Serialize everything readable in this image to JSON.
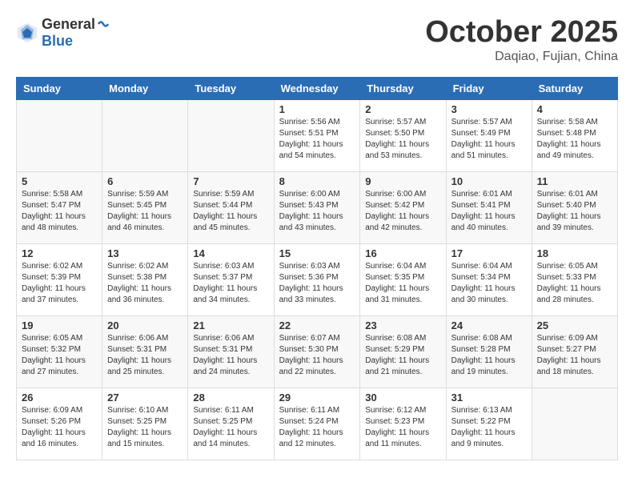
{
  "header": {
    "logo_general": "General",
    "logo_blue": "Blue",
    "month": "October 2025",
    "location": "Daqiao, Fujian, China"
  },
  "weekdays": [
    "Sunday",
    "Monday",
    "Tuesday",
    "Wednesday",
    "Thursday",
    "Friday",
    "Saturday"
  ],
  "weeks": [
    [
      {
        "day": "",
        "info": ""
      },
      {
        "day": "",
        "info": ""
      },
      {
        "day": "",
        "info": ""
      },
      {
        "day": "1",
        "info": "Sunrise: 5:56 AM\nSunset: 5:51 PM\nDaylight: 11 hours\nand 54 minutes."
      },
      {
        "day": "2",
        "info": "Sunrise: 5:57 AM\nSunset: 5:50 PM\nDaylight: 11 hours\nand 53 minutes."
      },
      {
        "day": "3",
        "info": "Sunrise: 5:57 AM\nSunset: 5:49 PM\nDaylight: 11 hours\nand 51 minutes."
      },
      {
        "day": "4",
        "info": "Sunrise: 5:58 AM\nSunset: 5:48 PM\nDaylight: 11 hours\nand 49 minutes."
      }
    ],
    [
      {
        "day": "5",
        "info": "Sunrise: 5:58 AM\nSunset: 5:47 PM\nDaylight: 11 hours\nand 48 minutes."
      },
      {
        "day": "6",
        "info": "Sunrise: 5:59 AM\nSunset: 5:45 PM\nDaylight: 11 hours\nand 46 minutes."
      },
      {
        "day": "7",
        "info": "Sunrise: 5:59 AM\nSunset: 5:44 PM\nDaylight: 11 hours\nand 45 minutes."
      },
      {
        "day": "8",
        "info": "Sunrise: 6:00 AM\nSunset: 5:43 PM\nDaylight: 11 hours\nand 43 minutes."
      },
      {
        "day": "9",
        "info": "Sunrise: 6:00 AM\nSunset: 5:42 PM\nDaylight: 11 hours\nand 42 minutes."
      },
      {
        "day": "10",
        "info": "Sunrise: 6:01 AM\nSunset: 5:41 PM\nDaylight: 11 hours\nand 40 minutes."
      },
      {
        "day": "11",
        "info": "Sunrise: 6:01 AM\nSunset: 5:40 PM\nDaylight: 11 hours\nand 39 minutes."
      }
    ],
    [
      {
        "day": "12",
        "info": "Sunrise: 6:02 AM\nSunset: 5:39 PM\nDaylight: 11 hours\nand 37 minutes."
      },
      {
        "day": "13",
        "info": "Sunrise: 6:02 AM\nSunset: 5:38 PM\nDaylight: 11 hours\nand 36 minutes."
      },
      {
        "day": "14",
        "info": "Sunrise: 6:03 AM\nSunset: 5:37 PM\nDaylight: 11 hours\nand 34 minutes."
      },
      {
        "day": "15",
        "info": "Sunrise: 6:03 AM\nSunset: 5:36 PM\nDaylight: 11 hours\nand 33 minutes."
      },
      {
        "day": "16",
        "info": "Sunrise: 6:04 AM\nSunset: 5:35 PM\nDaylight: 11 hours\nand 31 minutes."
      },
      {
        "day": "17",
        "info": "Sunrise: 6:04 AM\nSunset: 5:34 PM\nDaylight: 11 hours\nand 30 minutes."
      },
      {
        "day": "18",
        "info": "Sunrise: 6:05 AM\nSunset: 5:33 PM\nDaylight: 11 hours\nand 28 minutes."
      }
    ],
    [
      {
        "day": "19",
        "info": "Sunrise: 6:05 AM\nSunset: 5:32 PM\nDaylight: 11 hours\nand 27 minutes."
      },
      {
        "day": "20",
        "info": "Sunrise: 6:06 AM\nSunset: 5:31 PM\nDaylight: 11 hours\nand 25 minutes."
      },
      {
        "day": "21",
        "info": "Sunrise: 6:06 AM\nSunset: 5:31 PM\nDaylight: 11 hours\nand 24 minutes."
      },
      {
        "day": "22",
        "info": "Sunrise: 6:07 AM\nSunset: 5:30 PM\nDaylight: 11 hours\nand 22 minutes."
      },
      {
        "day": "23",
        "info": "Sunrise: 6:08 AM\nSunset: 5:29 PM\nDaylight: 11 hours\nand 21 minutes."
      },
      {
        "day": "24",
        "info": "Sunrise: 6:08 AM\nSunset: 5:28 PM\nDaylight: 11 hours\nand 19 minutes."
      },
      {
        "day": "25",
        "info": "Sunrise: 6:09 AM\nSunset: 5:27 PM\nDaylight: 11 hours\nand 18 minutes."
      }
    ],
    [
      {
        "day": "26",
        "info": "Sunrise: 6:09 AM\nSunset: 5:26 PM\nDaylight: 11 hours\nand 16 minutes."
      },
      {
        "day": "27",
        "info": "Sunrise: 6:10 AM\nSunset: 5:25 PM\nDaylight: 11 hours\nand 15 minutes."
      },
      {
        "day": "28",
        "info": "Sunrise: 6:11 AM\nSunset: 5:25 PM\nDaylight: 11 hours\nand 14 minutes."
      },
      {
        "day": "29",
        "info": "Sunrise: 6:11 AM\nSunset: 5:24 PM\nDaylight: 11 hours\nand 12 minutes."
      },
      {
        "day": "30",
        "info": "Sunrise: 6:12 AM\nSunset: 5:23 PM\nDaylight: 11 hours\nand 11 minutes."
      },
      {
        "day": "31",
        "info": "Sunrise: 6:13 AM\nSunset: 5:22 PM\nDaylight: 11 hours\nand 9 minutes."
      },
      {
        "day": "",
        "info": ""
      }
    ]
  ]
}
